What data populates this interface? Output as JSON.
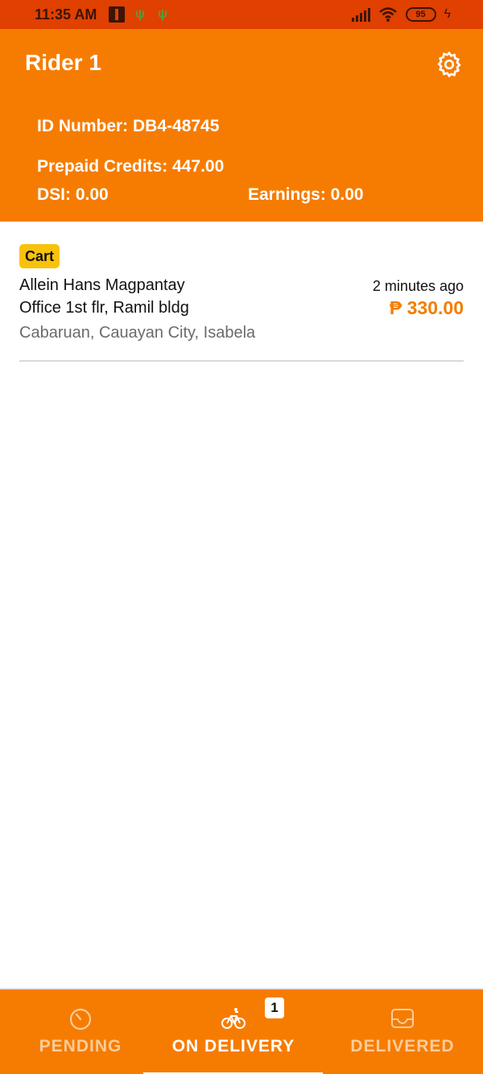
{
  "status_bar": {
    "time": "11:35 AM",
    "battery": "95"
  },
  "header": {
    "title": "Rider 1",
    "id_number": "ID Number: DB4-48745",
    "prepaid_credits": "Prepaid Credits: 447.00",
    "dsi": "DSI: 0.00",
    "earnings": "Earnings: 0.00",
    "settings_icon": "gear-icon"
  },
  "orders": [
    {
      "badge": "Cart",
      "customer": "Allein Hans Magpantay",
      "address": "Office 1st flr, Ramil bldg",
      "city": "Cabaruan, Cauayan City, Isabela",
      "time_ago": "2 minutes ago",
      "price": "₱ 330.00"
    }
  ],
  "bottom_nav": {
    "items": [
      {
        "label": "PENDING",
        "icon": "timer-icon",
        "active": false
      },
      {
        "label": "ON DELIVERY",
        "icon": "bicycle-icon",
        "active": true,
        "badge": "1"
      },
      {
        "label": "DELIVERED",
        "icon": "inbox-icon",
        "active": false
      }
    ]
  },
  "colors": {
    "primary": "#f67c01",
    "status_bar": "#e04000",
    "badge": "#f8c20a",
    "price": "#f07e00"
  }
}
